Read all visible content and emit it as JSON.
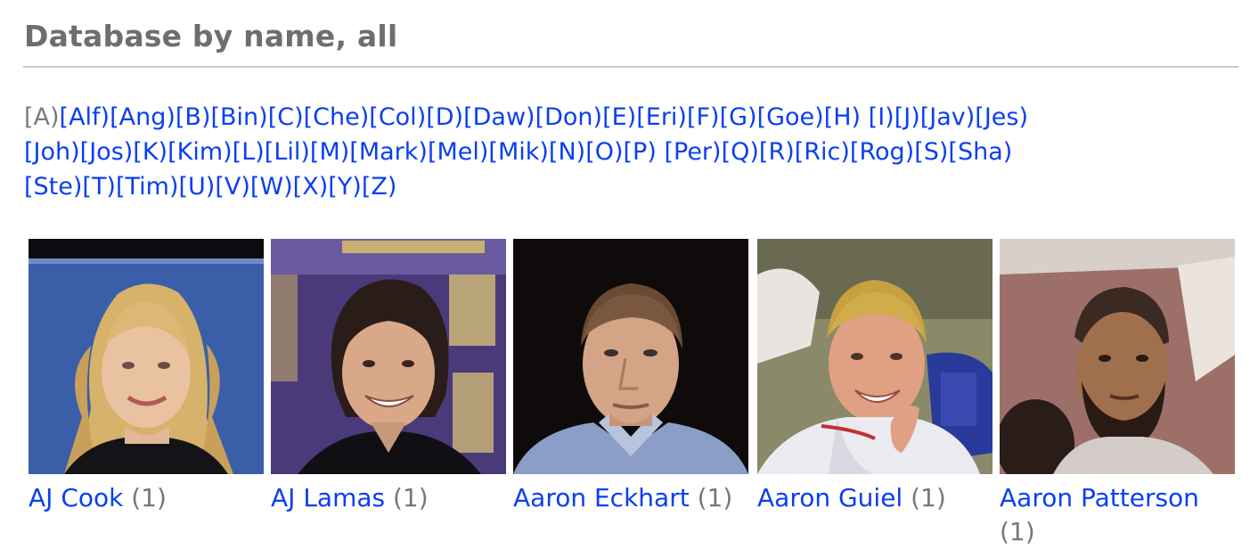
{
  "page": {
    "title": "Database by name, all"
  },
  "alpha_index": {
    "current": "[A)",
    "links": [
      "[Alf)",
      "[Ang)",
      "[B)",
      "[Bin)",
      "[C)",
      "[Che)",
      "[Col)",
      "[D)",
      "[Daw)",
      "[Don)",
      "[E)",
      "[Eri)",
      "[F)",
      "[G)",
      "[Goe)",
      "[H)",
      "[I)",
      "[J)",
      "[Jav)",
      "[Jes)",
      "[Joh)",
      "[Jos)",
      "[K)",
      "[Kim)",
      "[L)",
      "[Lil)",
      "[M)",
      "[Mark)",
      "[Mel)",
      "[Mik)",
      "[N)",
      "[O)",
      "[P)",
      "[Per)",
      "[Q)",
      "[R)",
      "[Ric)",
      "[Rog)",
      "[S)",
      "[Sha)",
      "[Ste)",
      "[T)",
      "[Tim)",
      "[U)",
      "[V)",
      "[W)",
      "[X)",
      "[Y)",
      "[Z)"
    ]
  },
  "people": [
    {
      "name": "AJ Cook",
      "count": "(1)"
    },
    {
      "name": "AJ Lamas",
      "count": "(1)"
    },
    {
      "name": "Aaron Eckhart",
      "count": "(1)"
    },
    {
      "name": "Aaron Guiel",
      "count": "(1)"
    },
    {
      "name": "Aaron Patterson",
      "count": "(1)"
    }
  ],
  "colors": {
    "link": "#0b3ff0",
    "title": "#6e6e6e",
    "muted": "#777777",
    "rule": "#cccccc"
  }
}
